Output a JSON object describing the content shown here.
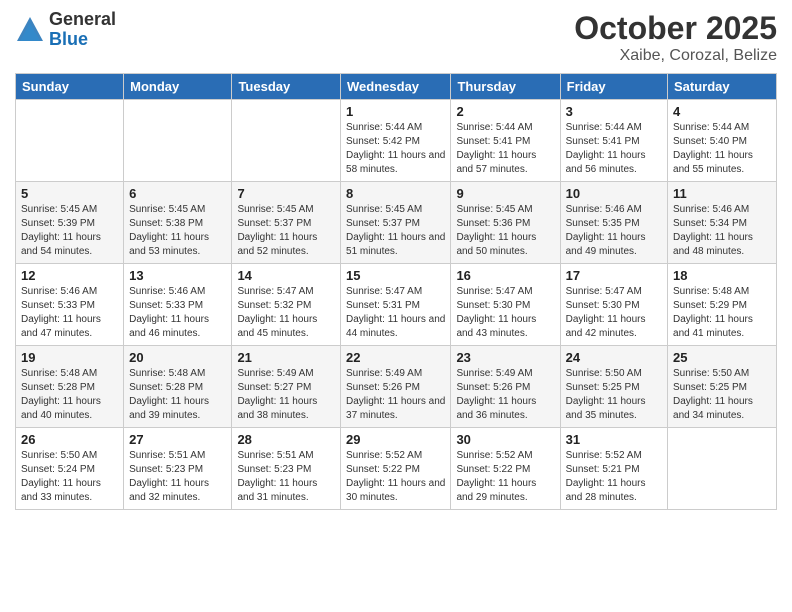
{
  "logo": {
    "general": "General",
    "blue": "Blue"
  },
  "title": "October 2025",
  "subtitle": "Xaibe, Corozal, Belize",
  "days_of_week": [
    "Sunday",
    "Monday",
    "Tuesday",
    "Wednesday",
    "Thursday",
    "Friday",
    "Saturday"
  ],
  "weeks": [
    [
      {
        "day": "",
        "info": ""
      },
      {
        "day": "",
        "info": ""
      },
      {
        "day": "",
        "info": ""
      },
      {
        "day": "1",
        "info": "Sunrise: 5:44 AM\nSunset: 5:42 PM\nDaylight: 11 hours and 58 minutes."
      },
      {
        "day": "2",
        "info": "Sunrise: 5:44 AM\nSunset: 5:41 PM\nDaylight: 11 hours and 57 minutes."
      },
      {
        "day": "3",
        "info": "Sunrise: 5:44 AM\nSunset: 5:41 PM\nDaylight: 11 hours and 56 minutes."
      },
      {
        "day": "4",
        "info": "Sunrise: 5:44 AM\nSunset: 5:40 PM\nDaylight: 11 hours and 55 minutes."
      }
    ],
    [
      {
        "day": "5",
        "info": "Sunrise: 5:45 AM\nSunset: 5:39 PM\nDaylight: 11 hours and 54 minutes."
      },
      {
        "day": "6",
        "info": "Sunrise: 5:45 AM\nSunset: 5:38 PM\nDaylight: 11 hours and 53 minutes."
      },
      {
        "day": "7",
        "info": "Sunrise: 5:45 AM\nSunset: 5:37 PM\nDaylight: 11 hours and 52 minutes."
      },
      {
        "day": "8",
        "info": "Sunrise: 5:45 AM\nSunset: 5:37 PM\nDaylight: 11 hours and 51 minutes."
      },
      {
        "day": "9",
        "info": "Sunrise: 5:45 AM\nSunset: 5:36 PM\nDaylight: 11 hours and 50 minutes."
      },
      {
        "day": "10",
        "info": "Sunrise: 5:46 AM\nSunset: 5:35 PM\nDaylight: 11 hours and 49 minutes."
      },
      {
        "day": "11",
        "info": "Sunrise: 5:46 AM\nSunset: 5:34 PM\nDaylight: 11 hours and 48 minutes."
      }
    ],
    [
      {
        "day": "12",
        "info": "Sunrise: 5:46 AM\nSunset: 5:33 PM\nDaylight: 11 hours and 47 minutes."
      },
      {
        "day": "13",
        "info": "Sunrise: 5:46 AM\nSunset: 5:33 PM\nDaylight: 11 hours and 46 minutes."
      },
      {
        "day": "14",
        "info": "Sunrise: 5:47 AM\nSunset: 5:32 PM\nDaylight: 11 hours and 45 minutes."
      },
      {
        "day": "15",
        "info": "Sunrise: 5:47 AM\nSunset: 5:31 PM\nDaylight: 11 hours and 44 minutes."
      },
      {
        "day": "16",
        "info": "Sunrise: 5:47 AM\nSunset: 5:30 PM\nDaylight: 11 hours and 43 minutes."
      },
      {
        "day": "17",
        "info": "Sunrise: 5:47 AM\nSunset: 5:30 PM\nDaylight: 11 hours and 42 minutes."
      },
      {
        "day": "18",
        "info": "Sunrise: 5:48 AM\nSunset: 5:29 PM\nDaylight: 11 hours and 41 minutes."
      }
    ],
    [
      {
        "day": "19",
        "info": "Sunrise: 5:48 AM\nSunset: 5:28 PM\nDaylight: 11 hours and 40 minutes."
      },
      {
        "day": "20",
        "info": "Sunrise: 5:48 AM\nSunset: 5:28 PM\nDaylight: 11 hours and 39 minutes."
      },
      {
        "day": "21",
        "info": "Sunrise: 5:49 AM\nSunset: 5:27 PM\nDaylight: 11 hours and 38 minutes."
      },
      {
        "day": "22",
        "info": "Sunrise: 5:49 AM\nSunset: 5:26 PM\nDaylight: 11 hours and 37 minutes."
      },
      {
        "day": "23",
        "info": "Sunrise: 5:49 AM\nSunset: 5:26 PM\nDaylight: 11 hours and 36 minutes."
      },
      {
        "day": "24",
        "info": "Sunrise: 5:50 AM\nSunset: 5:25 PM\nDaylight: 11 hours and 35 minutes."
      },
      {
        "day": "25",
        "info": "Sunrise: 5:50 AM\nSunset: 5:25 PM\nDaylight: 11 hours and 34 minutes."
      }
    ],
    [
      {
        "day": "26",
        "info": "Sunrise: 5:50 AM\nSunset: 5:24 PM\nDaylight: 11 hours and 33 minutes."
      },
      {
        "day": "27",
        "info": "Sunrise: 5:51 AM\nSunset: 5:23 PM\nDaylight: 11 hours and 32 minutes."
      },
      {
        "day": "28",
        "info": "Sunrise: 5:51 AM\nSunset: 5:23 PM\nDaylight: 11 hours and 31 minutes."
      },
      {
        "day": "29",
        "info": "Sunrise: 5:52 AM\nSunset: 5:22 PM\nDaylight: 11 hours and 30 minutes."
      },
      {
        "day": "30",
        "info": "Sunrise: 5:52 AM\nSunset: 5:22 PM\nDaylight: 11 hours and 29 minutes."
      },
      {
        "day": "31",
        "info": "Sunrise: 5:52 AM\nSunset: 5:21 PM\nDaylight: 11 hours and 28 minutes."
      },
      {
        "day": "",
        "info": ""
      }
    ]
  ]
}
